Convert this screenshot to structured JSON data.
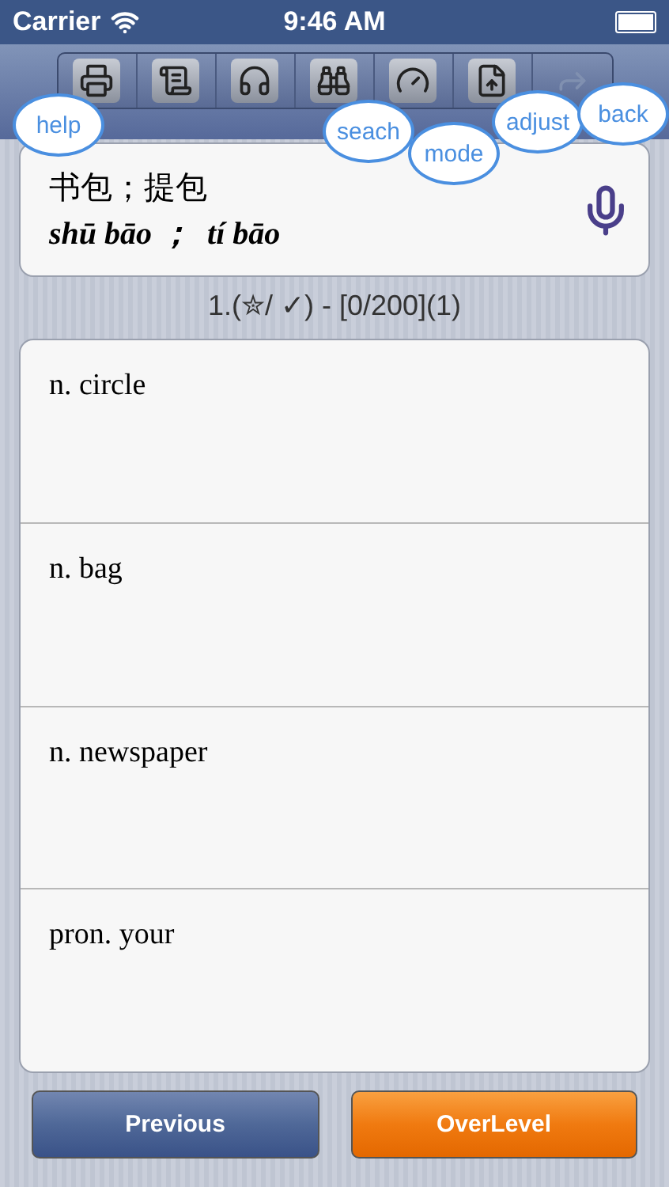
{
  "status_bar": {
    "carrier": "Carrier",
    "time": "9:46 AM"
  },
  "toolbar": [
    {
      "kind": "printer",
      "disabled": false
    },
    {
      "kind": "script",
      "disabled": false
    },
    {
      "kind": "headphones",
      "disabled": false
    },
    {
      "kind": "binoculars",
      "disabled": false
    },
    {
      "kind": "dial",
      "disabled": false
    },
    {
      "kind": "upload",
      "disabled": false
    },
    {
      "kind": "share",
      "disabled": true
    }
  ],
  "hints": [
    {
      "kind": "help",
      "label": "help"
    },
    {
      "kind": "search",
      "label": "seach"
    },
    {
      "kind": "mode",
      "label": "mode"
    },
    {
      "kind": "adjust",
      "label": "adjust"
    },
    {
      "kind": "back",
      "label": "back"
    }
  ],
  "word": {
    "hanzi": "书包；提包",
    "pinyin": "shū bāo ；  tí bāo"
  },
  "counter": "1.(✮/ ✓) - [0/200](1)",
  "options": [
    {
      "text": "n. circle"
    },
    {
      "text": "n. bag"
    },
    {
      "text": "n. newspaper"
    },
    {
      "text": "pron. your"
    }
  ],
  "buttons": [
    {
      "kind": "previous",
      "label": "Previous"
    },
    {
      "kind": "overlevel",
      "label": "OverLevel"
    }
  ]
}
